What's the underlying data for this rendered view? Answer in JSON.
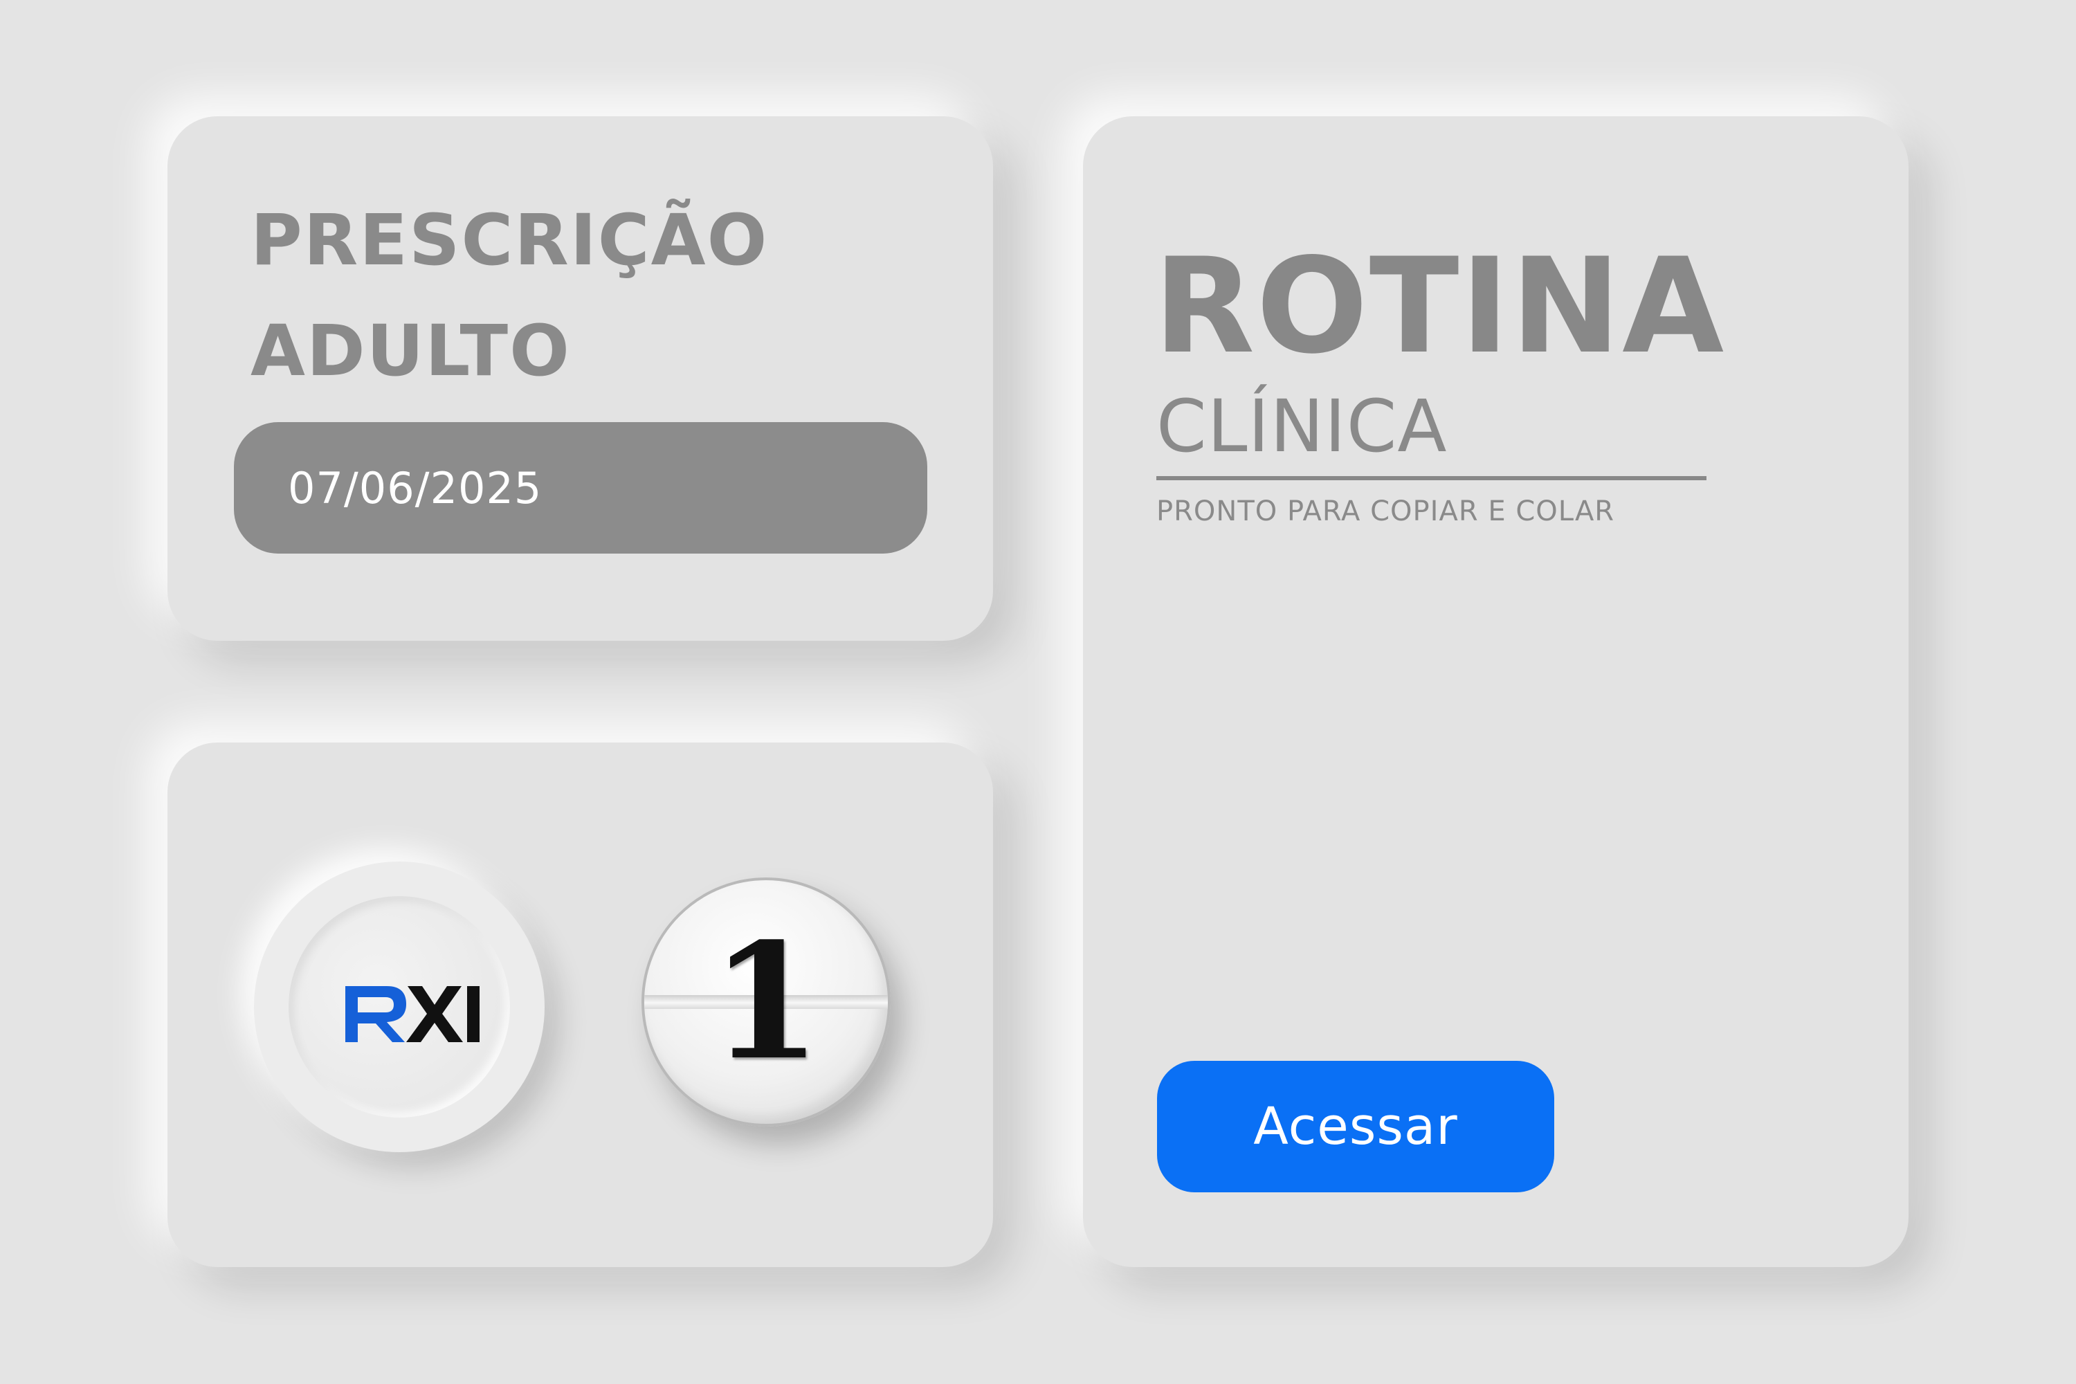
{
  "prescricao_card": {
    "title_line1": "PRESCRIÇÃO",
    "title_line2": "ADULTO",
    "date": "07/06/2025"
  },
  "icons_card": {
    "logo_text": "RXI",
    "logo_colors": {
      "r": "#1560d8",
      "xi": "#111111"
    },
    "pill_number": "1"
  },
  "rotina_card": {
    "title": "ROTINA",
    "subtitle": "CLÍNICA",
    "tagline": "PRONTO PARA COPIAR E COLAR",
    "button_label": "Acessar"
  },
  "colors": {
    "background": "#e4e4e4",
    "card": "#e3e3e3",
    "text_gray": "#8a8a8a",
    "date_pill": "#8c8c8c",
    "accent_blue": "#0a70f5"
  }
}
